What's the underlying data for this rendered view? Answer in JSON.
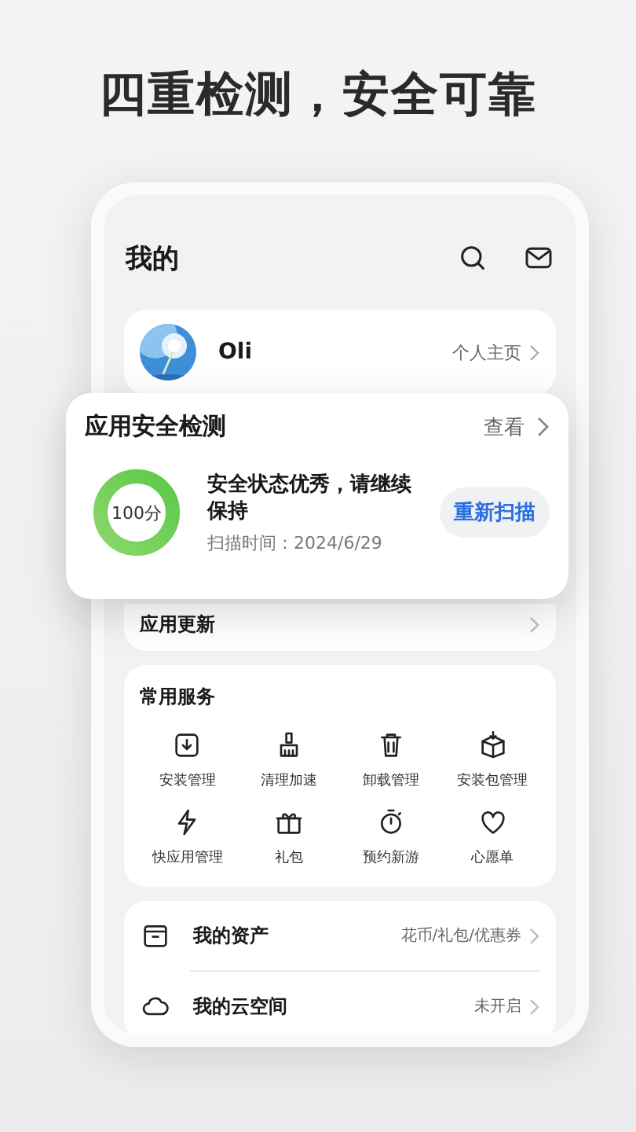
{
  "headline": "四重检测，安全可靠",
  "page": {
    "title": "我的"
  },
  "profile": {
    "name": "Oli",
    "link": "个人主页"
  },
  "security_card": {
    "title": "应用安全检测",
    "view": "查看",
    "score": "100分",
    "level": 1,
    "status": "安全状态优秀，请继续保持",
    "scan_time": "扫描时间：2024/6/29",
    "rescan": "重新扫描"
  },
  "update_row": {
    "label": "应用更新"
  },
  "services": {
    "title": "常用服务",
    "items": [
      {
        "label": "安装管理"
      },
      {
        "label": "清理加速"
      },
      {
        "label": "卸载管理"
      },
      {
        "label": "安装包管理"
      },
      {
        "label": "快应用管理"
      },
      {
        "label": "礼包"
      },
      {
        "label": "预约新游"
      },
      {
        "label": "心愿单"
      }
    ]
  },
  "list": [
    {
      "label": "我的资产",
      "value": "花币/礼包/优惠券"
    },
    {
      "label": "我的云空间",
      "value": "未开启"
    }
  ]
}
